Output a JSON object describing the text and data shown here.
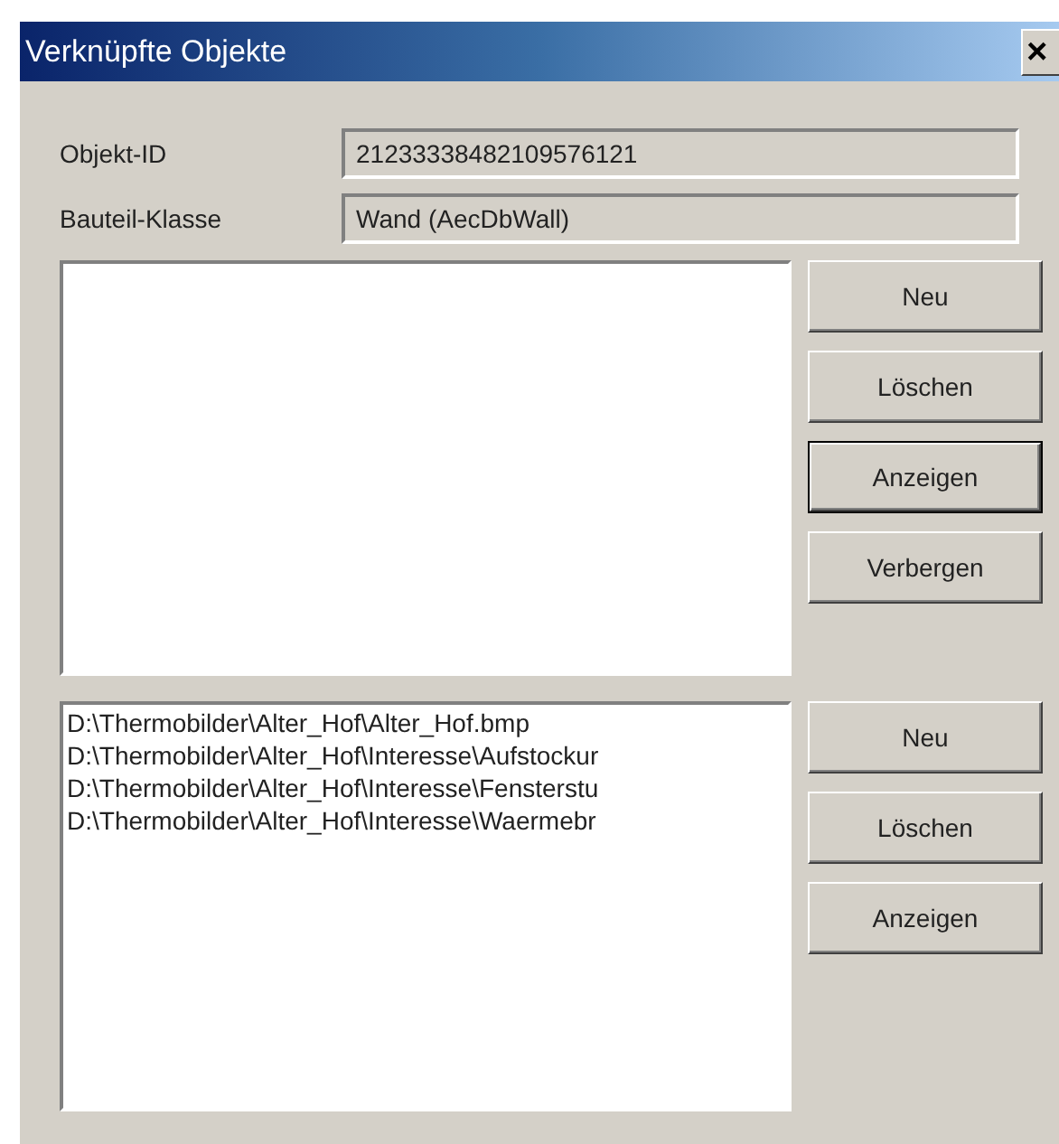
{
  "window": {
    "title": "Verknüpfte Objekte",
    "close": "×"
  },
  "fields": [
    {
      "label": "Objekt-ID",
      "value": "21233338482109576121"
    },
    {
      "label": "Bauteil-Klasse",
      "value": "Wand (AecDbWall)"
    }
  ],
  "lists": [
    {
      "buttons": [
        {
          "label": "Neu",
          "default": false
        },
        {
          "label": "Löschen",
          "default": false
        },
        {
          "label": "Anzeigen",
          "default": true
        },
        {
          "label": "Verbergen",
          "default": false
        }
      ]
    },
    {
      "items": [
        "D:\\Thermobilder\\Alter_Hof\\Alter_Hof.bmp",
        "D:\\Thermobilder\\Alter_Hof\\Interesse\\Aufstockur",
        "D:\\Thermobilder\\Alter_Hof\\Interesse\\Fensterstu",
        "D:\\Thermobilder\\Alter_Hof\\Interesse\\Waermebr"
      ],
      "buttons": [
        {
          "label": "Neu",
          "default": false
        },
        {
          "label": "Löschen",
          "default": false
        },
        {
          "label": "Anzeigen",
          "default": false
        }
      ]
    }
  ]
}
